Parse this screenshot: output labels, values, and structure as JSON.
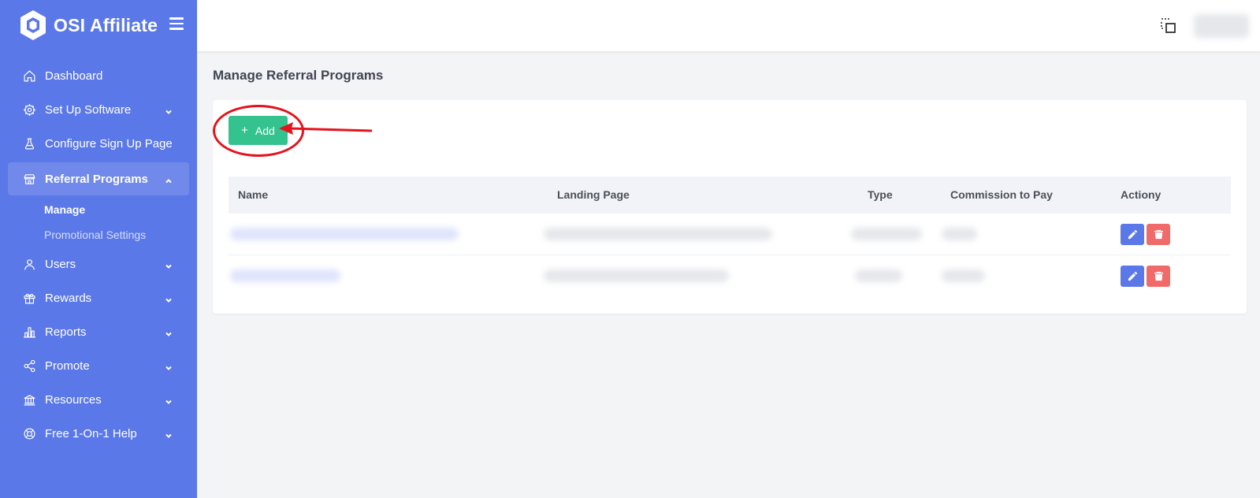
{
  "brand": {
    "name": "OSI Affiliate"
  },
  "sidebar": {
    "items": [
      {
        "label": "Dashboard"
      },
      {
        "label": "Set Up Software"
      },
      {
        "label": "Configure Sign Up Page"
      },
      {
        "label": "Referral Programs"
      },
      {
        "label": "Users"
      },
      {
        "label": "Rewards"
      },
      {
        "label": "Reports"
      },
      {
        "label": "Promote"
      },
      {
        "label": "Resources"
      },
      {
        "label": "Free 1-On-1 Help"
      }
    ],
    "subitems": [
      {
        "label": "Manage"
      },
      {
        "label": "Promotional Settings"
      }
    ]
  },
  "main": {
    "title": "Manage Referral Programs",
    "add_label": "Add",
    "add_plus": "+",
    "table": {
      "headers": [
        "Name",
        "Landing Page",
        "Type",
        "Commission to Pay",
        "Actiony"
      ]
    }
  },
  "colors": {
    "sidebar": "#5b78e8",
    "add": "#34c38f",
    "delete": "#f06a6a",
    "annotation": "#e3141c"
  }
}
